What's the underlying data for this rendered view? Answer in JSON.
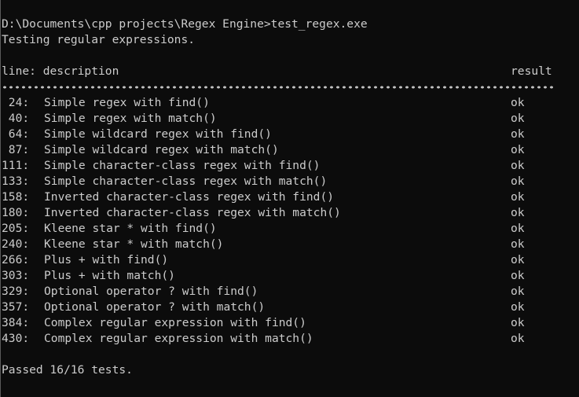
{
  "prompt": "D:\\Documents\\cpp projects\\Regex Engine>test_regex.exe",
  "intro": "Testing regular expressions.",
  "header": {
    "description": "line: description",
    "result": "result"
  },
  "separator": "~~~~~~~~~~~~~~~~~~~~~~~~~~~~~~~~~~~~~~~~~~~~~~~~~~~~~~~~~~~~~~~~~~~~~~~~~~~~~~~~~~~~~~~~~~~",
  "tests": [
    {
      "line": " 24:",
      "description": "Simple regex with find()",
      "result": "ok"
    },
    {
      "line": " 40:",
      "description": "Simple regex with match()",
      "result": "ok"
    },
    {
      "line": " 64:",
      "description": "Simple wildcard regex with find()",
      "result": "ok"
    },
    {
      "line": " 87:",
      "description": "Simple wildcard regex with match()",
      "result": "ok"
    },
    {
      "line": "111:",
      "description": "Simple character-class regex with find()",
      "result": "ok"
    },
    {
      "line": "133:",
      "description": "Simple character-class regex with match()",
      "result": "ok"
    },
    {
      "line": "158:",
      "description": "Inverted character-class regex with find()",
      "result": "ok"
    },
    {
      "line": "180:",
      "description": "Inverted character-class regex with match()",
      "result": "ok"
    },
    {
      "line": "205:",
      "description": "Kleene star * with find()",
      "result": "ok"
    },
    {
      "line": "240:",
      "description": "Kleene star * with match()",
      "result": "ok"
    },
    {
      "line": "266:",
      "description": "Plus + with find()",
      "result": "ok"
    },
    {
      "line": "303:",
      "description": "Plus + with match()",
      "result": "ok"
    },
    {
      "line": "329:",
      "description": "Optional operator ? with find()",
      "result": "ok"
    },
    {
      "line": "357:",
      "description": "Optional operator ? with match()",
      "result": "ok"
    },
    {
      "line": "384:",
      "description": "Complex regular expression with find()",
      "result": "ok"
    },
    {
      "line": "430:",
      "description": "Complex regular expression with match()",
      "result": "ok"
    }
  ],
  "summary": "Passed 16/16 tests.",
  "colors": {
    "background": "#0c0c0c",
    "text": "#cccccc"
  }
}
